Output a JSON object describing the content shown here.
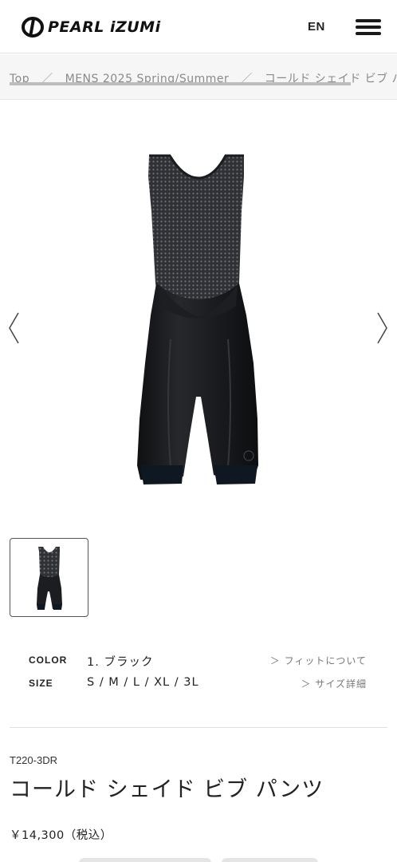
{
  "header": {
    "brand": "PEARL iZUMi",
    "language": "EN"
  },
  "breadcrumb": {
    "items": [
      "Top",
      "MENS 2025 Spring/Summer",
      "コールド シェイド ビブ パンツ"
    ],
    "separator": "／"
  },
  "product": {
    "code": "T220-3DR",
    "name": "コールド シェイド ビブ パンツ",
    "price": "￥14,300（税込）",
    "color_label": "COLOR",
    "color_value": "1. ブラック",
    "fit_link": "＞ フィットについて",
    "size_label": "SIZE",
    "size_value": "S / M / L / XL / 3L",
    "size_link": "＞ サイズ詳細"
  },
  "gallery": {
    "prev_icon": "chevron-left-icon",
    "next_icon": "chevron-right-icon",
    "image": "black-cycling-bib-shorts"
  },
  "colors": {
    "garment": "#1b1c1e",
    "mesh": "#3b3d41",
    "cuff": "#0f1822"
  }
}
